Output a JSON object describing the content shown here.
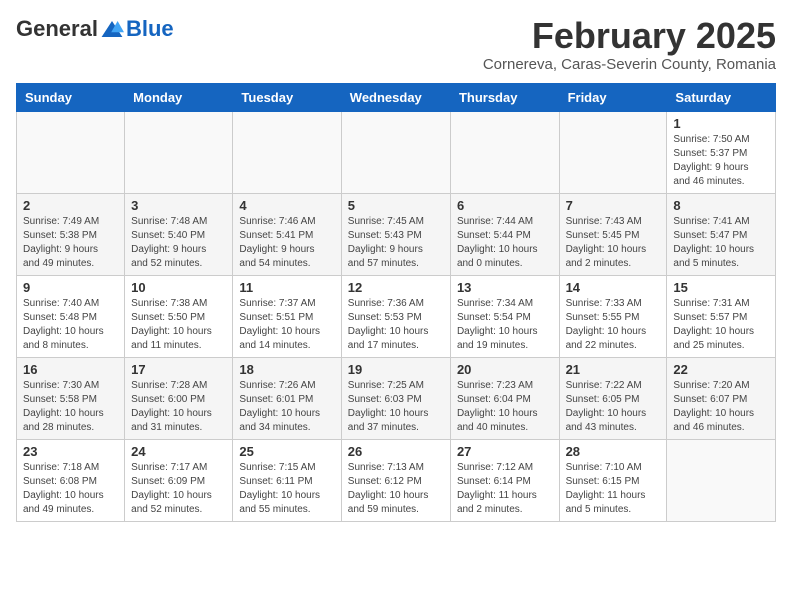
{
  "header": {
    "logo_general": "General",
    "logo_blue": "Blue",
    "month_title": "February 2025",
    "subtitle": "Cornereva, Caras-Severin County, Romania"
  },
  "weekdays": [
    "Sunday",
    "Monday",
    "Tuesday",
    "Wednesday",
    "Thursday",
    "Friday",
    "Saturday"
  ],
  "weeks": [
    [
      {
        "day": "",
        "info": ""
      },
      {
        "day": "",
        "info": ""
      },
      {
        "day": "",
        "info": ""
      },
      {
        "day": "",
        "info": ""
      },
      {
        "day": "",
        "info": ""
      },
      {
        "day": "",
        "info": ""
      },
      {
        "day": "1",
        "info": "Sunrise: 7:50 AM\nSunset: 5:37 PM\nDaylight: 9 hours\nand 46 minutes."
      }
    ],
    [
      {
        "day": "2",
        "info": "Sunrise: 7:49 AM\nSunset: 5:38 PM\nDaylight: 9 hours\nand 49 minutes."
      },
      {
        "day": "3",
        "info": "Sunrise: 7:48 AM\nSunset: 5:40 PM\nDaylight: 9 hours\nand 52 minutes."
      },
      {
        "day": "4",
        "info": "Sunrise: 7:46 AM\nSunset: 5:41 PM\nDaylight: 9 hours\nand 54 minutes."
      },
      {
        "day": "5",
        "info": "Sunrise: 7:45 AM\nSunset: 5:43 PM\nDaylight: 9 hours\nand 57 minutes."
      },
      {
        "day": "6",
        "info": "Sunrise: 7:44 AM\nSunset: 5:44 PM\nDaylight: 10 hours\nand 0 minutes."
      },
      {
        "day": "7",
        "info": "Sunrise: 7:43 AM\nSunset: 5:45 PM\nDaylight: 10 hours\nand 2 minutes."
      },
      {
        "day": "8",
        "info": "Sunrise: 7:41 AM\nSunset: 5:47 PM\nDaylight: 10 hours\nand 5 minutes."
      }
    ],
    [
      {
        "day": "9",
        "info": "Sunrise: 7:40 AM\nSunset: 5:48 PM\nDaylight: 10 hours\nand 8 minutes."
      },
      {
        "day": "10",
        "info": "Sunrise: 7:38 AM\nSunset: 5:50 PM\nDaylight: 10 hours\nand 11 minutes."
      },
      {
        "day": "11",
        "info": "Sunrise: 7:37 AM\nSunset: 5:51 PM\nDaylight: 10 hours\nand 14 minutes."
      },
      {
        "day": "12",
        "info": "Sunrise: 7:36 AM\nSunset: 5:53 PM\nDaylight: 10 hours\nand 17 minutes."
      },
      {
        "day": "13",
        "info": "Sunrise: 7:34 AM\nSunset: 5:54 PM\nDaylight: 10 hours\nand 19 minutes."
      },
      {
        "day": "14",
        "info": "Sunrise: 7:33 AM\nSunset: 5:55 PM\nDaylight: 10 hours\nand 22 minutes."
      },
      {
        "day": "15",
        "info": "Sunrise: 7:31 AM\nSunset: 5:57 PM\nDaylight: 10 hours\nand 25 minutes."
      }
    ],
    [
      {
        "day": "16",
        "info": "Sunrise: 7:30 AM\nSunset: 5:58 PM\nDaylight: 10 hours\nand 28 minutes."
      },
      {
        "day": "17",
        "info": "Sunrise: 7:28 AM\nSunset: 6:00 PM\nDaylight: 10 hours\nand 31 minutes."
      },
      {
        "day": "18",
        "info": "Sunrise: 7:26 AM\nSunset: 6:01 PM\nDaylight: 10 hours\nand 34 minutes."
      },
      {
        "day": "19",
        "info": "Sunrise: 7:25 AM\nSunset: 6:03 PM\nDaylight: 10 hours\nand 37 minutes."
      },
      {
        "day": "20",
        "info": "Sunrise: 7:23 AM\nSunset: 6:04 PM\nDaylight: 10 hours\nand 40 minutes."
      },
      {
        "day": "21",
        "info": "Sunrise: 7:22 AM\nSunset: 6:05 PM\nDaylight: 10 hours\nand 43 minutes."
      },
      {
        "day": "22",
        "info": "Sunrise: 7:20 AM\nSunset: 6:07 PM\nDaylight: 10 hours\nand 46 minutes."
      }
    ],
    [
      {
        "day": "23",
        "info": "Sunrise: 7:18 AM\nSunset: 6:08 PM\nDaylight: 10 hours\nand 49 minutes."
      },
      {
        "day": "24",
        "info": "Sunrise: 7:17 AM\nSunset: 6:09 PM\nDaylight: 10 hours\nand 52 minutes."
      },
      {
        "day": "25",
        "info": "Sunrise: 7:15 AM\nSunset: 6:11 PM\nDaylight: 10 hours\nand 55 minutes."
      },
      {
        "day": "26",
        "info": "Sunrise: 7:13 AM\nSunset: 6:12 PM\nDaylight: 10 hours\nand 59 minutes."
      },
      {
        "day": "27",
        "info": "Sunrise: 7:12 AM\nSunset: 6:14 PM\nDaylight: 11 hours\nand 2 minutes."
      },
      {
        "day": "28",
        "info": "Sunrise: 7:10 AM\nSunset: 6:15 PM\nDaylight: 11 hours\nand 5 minutes."
      },
      {
        "day": "",
        "info": ""
      }
    ]
  ]
}
